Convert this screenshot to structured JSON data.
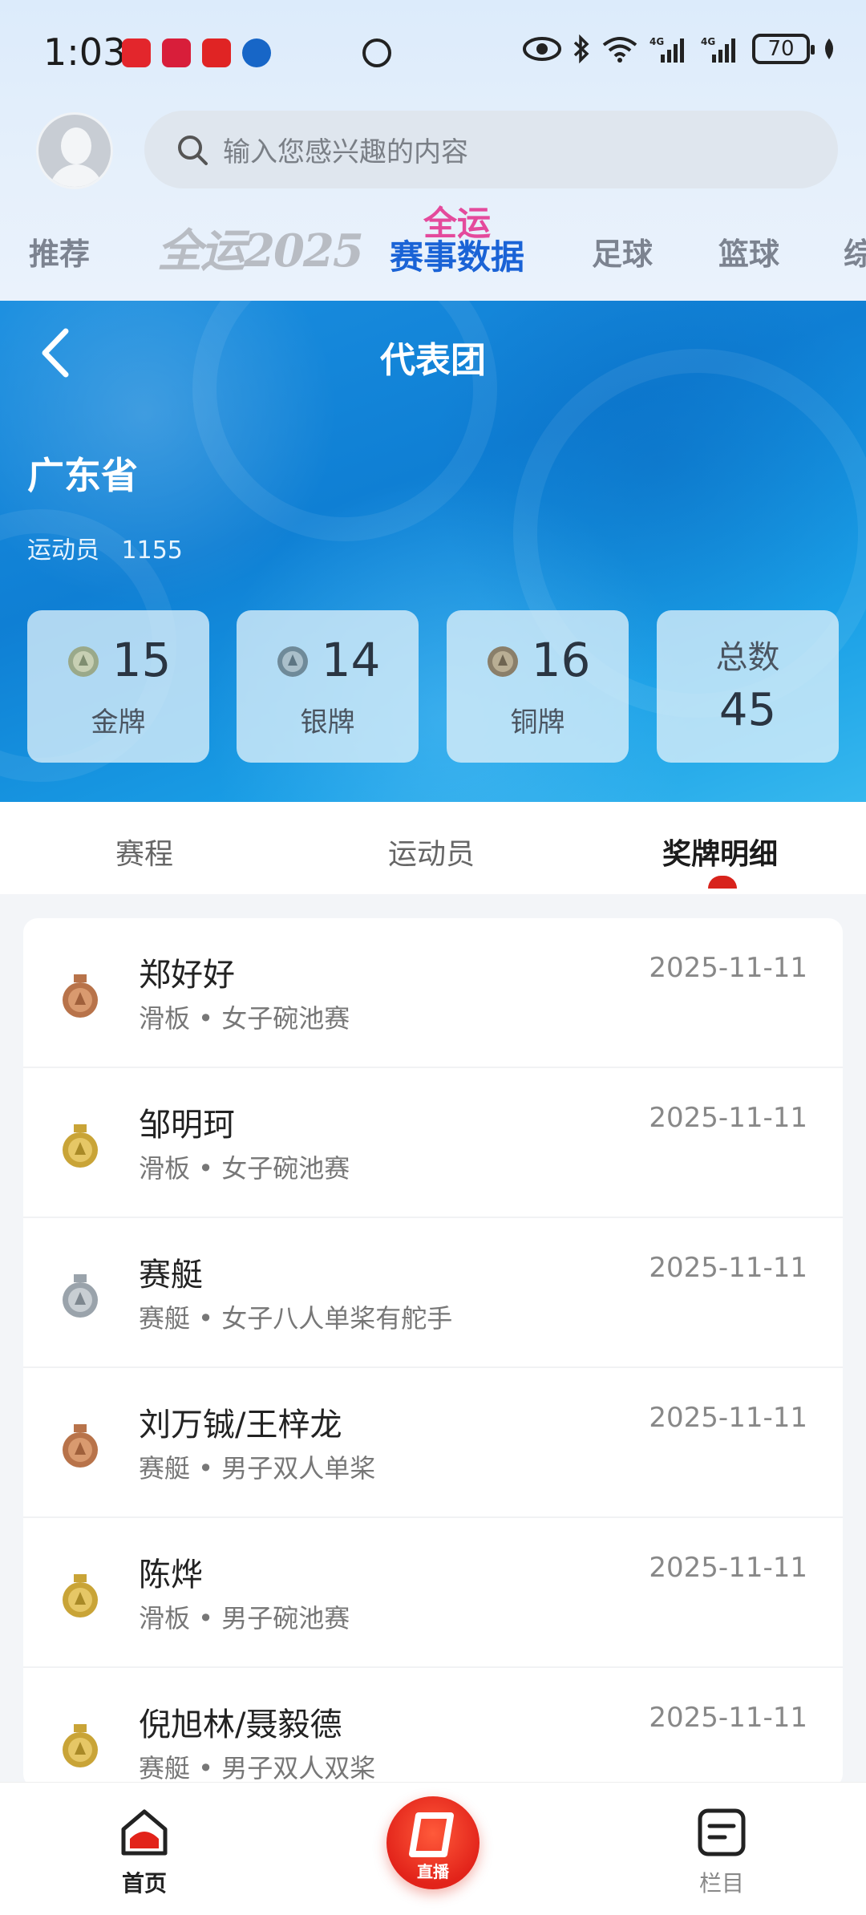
{
  "status_bar": {
    "time": "1:03",
    "battery": "70",
    "network": "4G"
  },
  "search": {
    "placeholder": "输入您感兴趣的内容"
  },
  "channel_tabs": {
    "items": [
      "推荐",
      "全运2025",
      "全运赛事数据",
      "足球",
      "篮球",
      "综"
    ],
    "data_tab_line1": "全运",
    "data_tab_line2": "赛事数据"
  },
  "banner": {
    "title": "代表团",
    "team_name": "广东省",
    "athlete_label": "运动员",
    "athlete_count": "1155",
    "medals": {
      "gold": {
        "count": "15",
        "label": "金牌"
      },
      "silver": {
        "count": "14",
        "label": "银牌"
      },
      "bronze": {
        "count": "16",
        "label": "铜牌"
      },
      "total": {
        "count": "45",
        "label": "总数"
      }
    }
  },
  "sub_tabs": {
    "schedule": "赛程",
    "athletes": "运动员",
    "medal_detail": "奖牌明细",
    "active": "medal_detail"
  },
  "medal_list": [
    {
      "name": "郑好好",
      "event": "滑板 • 女子碗池赛",
      "date": "2025-11-11",
      "medal": "bronze"
    },
    {
      "name": "邹明珂",
      "event": "滑板 • 女子碗池赛",
      "date": "2025-11-11",
      "medal": "gold"
    },
    {
      "name": "赛艇",
      "event": "赛艇 • 女子八人单桨有舵手",
      "date": "2025-11-11",
      "medal": "silver"
    },
    {
      "name": "刘万铖/王梓龙",
      "event": "赛艇 • 男子双人单桨",
      "date": "2025-11-11",
      "medal": "bronze"
    },
    {
      "name": "陈烨",
      "event": "滑板 • 男子碗池赛",
      "date": "2025-11-11",
      "medal": "gold"
    },
    {
      "name": "倪旭林/聂毅德",
      "event": "赛艇 • 男子双人双桨",
      "date": "2025-11-11",
      "medal": "gold"
    }
  ],
  "bottom_nav": {
    "home": "首页",
    "live": "直播",
    "columns": "栏目"
  },
  "colors": {
    "accent_red": "#d8231c",
    "banner_blue": "#1b8fe0",
    "gold": "#c9a437",
    "silver": "#9aa3ab",
    "bronze": "#b8734a"
  }
}
